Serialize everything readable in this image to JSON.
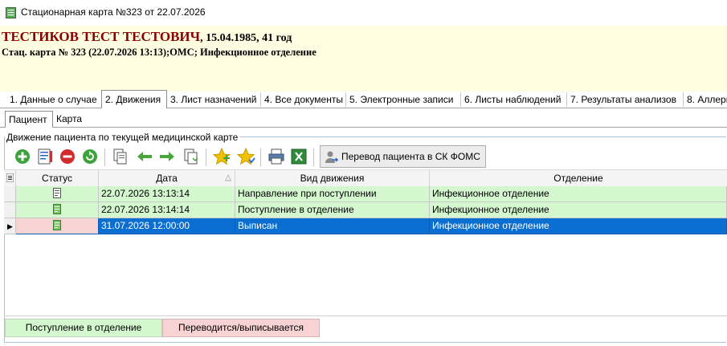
{
  "window": {
    "title": "Стационарная карта №323 от 22.07.2026",
    "icon": "medical-card-icon"
  },
  "patient": {
    "name": "ТЕСТИКОВ ТЕСТ ТЕСТОВИЧ",
    "dob_age": ", 15.04.1985, 41 год",
    "card_line": "Стац. карта  № 323 (22.07.2026 13:13);ОМС; Инфекционное отделение"
  },
  "main_tabs": [
    {
      "label": "1. Данные о случае"
    },
    {
      "label": "2. Движения"
    },
    {
      "label": "3. Лист назначений"
    },
    {
      "label": "4. Все документы"
    },
    {
      "label": "5. Электронные записи"
    },
    {
      "label": "6. Листы наблюдений"
    },
    {
      "label": "7. Результаты анализов"
    },
    {
      "label": "8. Аллерг"
    }
  ],
  "active_main_tab": "2. Движения",
  "sub_tabs": [
    {
      "label": "Пациент"
    },
    {
      "label": "Карта"
    }
  ],
  "active_sub_tab": "Пациент",
  "group": {
    "caption": "Движение пациента по текущей медицинской карте"
  },
  "toolbar": {
    "icons": [
      "add-icon",
      "edit-icon",
      "delete-icon",
      "refresh-icon",
      "copy-icon",
      "arrow-left-icon",
      "arrow-right-icon",
      "paste-icon",
      "star-add-icon",
      "star-icon",
      "print-icon",
      "excel-icon"
    ],
    "transfer_label": "Перевод пациента в СК ФОМС"
  },
  "grid": {
    "columns": [
      "Статус",
      "Дата",
      "Вид движения",
      "Отделение"
    ],
    "rows": [
      {
        "date": "22.07.2026 13:13:14",
        "type": "Направление при поступлении",
        "department": "Инфекционное отделение",
        "status_icon": "document-icon"
      },
      {
        "date": "22.07.2026 13:14:14",
        "type": "Поступление в отделение",
        "department": "Инфекционное отделение",
        "status_icon": "document-green-icon"
      },
      {
        "date": "31.07.2026 12:00:00",
        "type": "Выписан",
        "department": "Инфекционное отделение",
        "status_icon": "document-green-icon"
      }
    ],
    "selected_row": 2
  },
  "legend": {
    "green_label": "Поступление в отделение",
    "red_label": "Переводится/выписывается"
  },
  "colors": {
    "header_bg": "#fffde2",
    "patient_name": "#8b0000",
    "row_green": "#d4f7d0",
    "row_red": "#f7d3d3",
    "selection": "#0a6fd0"
  }
}
